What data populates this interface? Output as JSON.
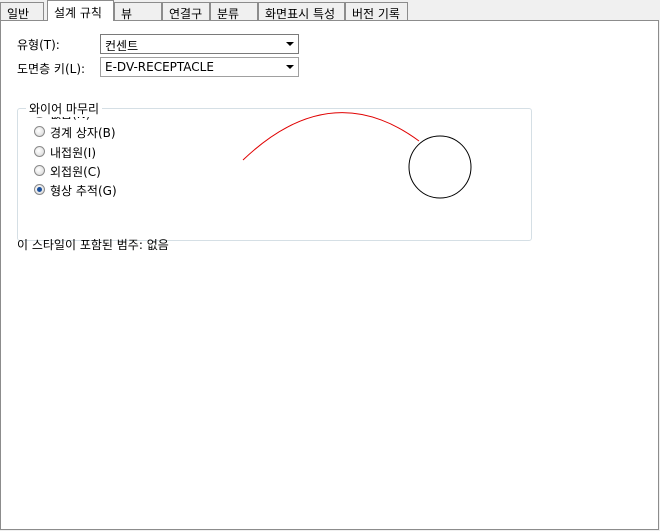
{
  "tabs": [
    {
      "label": "일반",
      "active": false
    },
    {
      "label": "설계 규칙",
      "active": true
    },
    {
      "label": "뷰",
      "active": false
    },
    {
      "label": "연결구",
      "active": false
    },
    {
      "label": "분류",
      "active": false
    },
    {
      "label": "화면표시 특성",
      "active": false
    },
    {
      "label": "버전 기록",
      "active": false
    }
  ],
  "form": {
    "type_label": "유형(T):",
    "type_value": "컨센트",
    "layer_key_label": "도면층 키(L):",
    "layer_key_value": "E-DV-RECEPTACLE"
  },
  "wire_end": {
    "group_title": "와이어 마무리",
    "options": [
      {
        "label": "없음(N)",
        "checked": false
      },
      {
        "label": "경계 상자(B)",
        "checked": false
      },
      {
        "label": "내접원(I)",
        "checked": false
      },
      {
        "label": "외접원(C)",
        "checked": false
      },
      {
        "label": "형상 추적(G)",
        "checked": true
      }
    ],
    "preview_colors": {
      "wire": "#e00000",
      "shape": "#000000"
    }
  },
  "footer": {
    "categories_text": "이 스타일이 포함된 범주: 없음"
  }
}
